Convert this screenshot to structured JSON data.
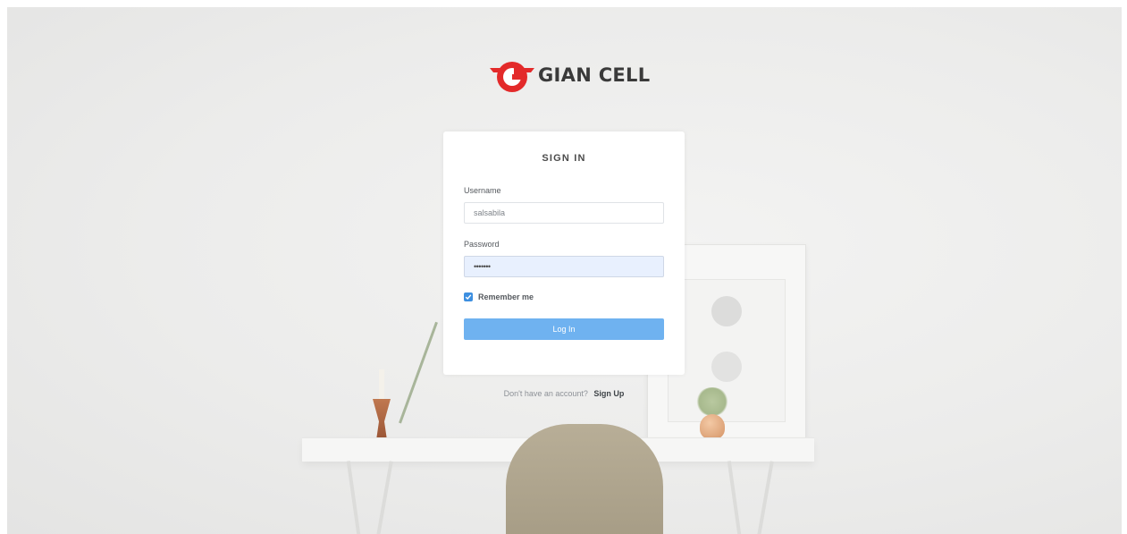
{
  "brand": {
    "name": "GIAN CELL",
    "accent_color": "#e32a2a"
  },
  "login": {
    "title": "SIGN IN",
    "username": {
      "label": "Username",
      "value": "salsabila"
    },
    "password": {
      "label": "Password",
      "value": "•••••••"
    },
    "remember": {
      "label": "Remember me",
      "checked": true
    },
    "submit_label": "Log In",
    "button_color": "#6fb2f0"
  },
  "footer": {
    "prompt": "Don't have an account?",
    "link_label": "Sign Up"
  }
}
